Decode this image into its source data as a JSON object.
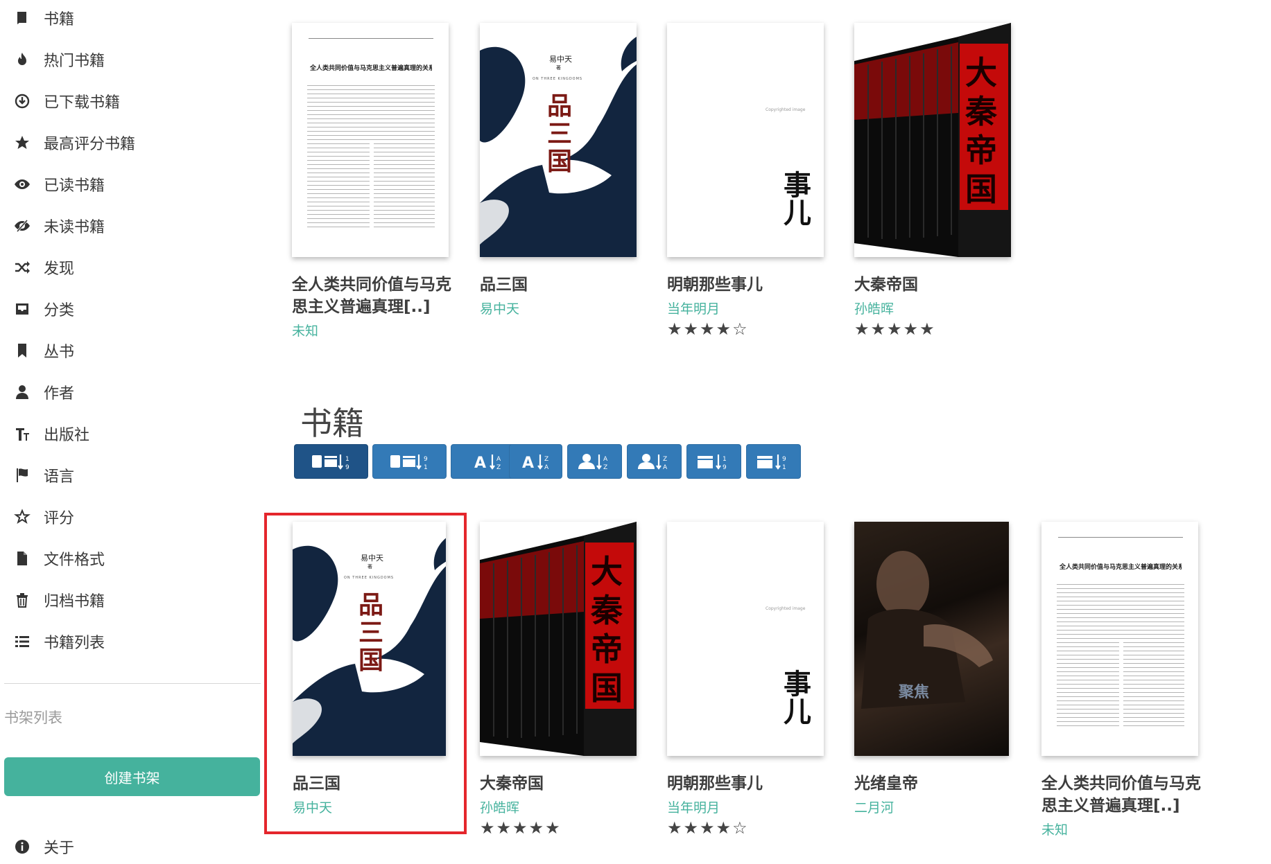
{
  "sidebar": {
    "items": [
      {
        "label": "书籍",
        "icon": "book-icon"
      },
      {
        "label": "热门书籍",
        "icon": "fire-icon"
      },
      {
        "label": "已下载书籍",
        "icon": "download-icon"
      },
      {
        "label": "最高评分书籍",
        "icon": "star-icon"
      },
      {
        "label": "已读书籍",
        "icon": "eye-icon"
      },
      {
        "label": "未读书籍",
        "icon": "eye-slash-icon"
      },
      {
        "label": "发现",
        "icon": "shuffle-icon"
      },
      {
        "label": "分类",
        "icon": "inbox-icon"
      },
      {
        "label": "丛书",
        "icon": "bookmark-icon"
      },
      {
        "label": "作者",
        "icon": "user-icon"
      },
      {
        "label": "出版社",
        "icon": "text-size-icon"
      },
      {
        "label": "语言",
        "icon": "flag-icon"
      },
      {
        "label": "评分",
        "icon": "star-outline-icon"
      },
      {
        "label": "文件格式",
        "icon": "file-icon"
      },
      {
        "label": "归档书籍",
        "icon": "trash-icon"
      },
      {
        "label": "书籍列表",
        "icon": "list-icon"
      }
    ],
    "shelf_heading": "书架列表",
    "create_shelf": "创建书架",
    "about": {
      "label": "关于",
      "icon": "info-icon"
    }
  },
  "top_books": [
    {
      "title": "全人类共同价值与马克思主义普遍真理[..]",
      "author": "未知",
      "rating": "",
      "cover": "article"
    },
    {
      "title": "品三国",
      "author": "易中天",
      "rating": "",
      "cover": "pin-san-guo"
    },
    {
      "title": "明朝那些事儿",
      "author": "当年明月",
      "rating": "★★★★☆",
      "cover": "ming-chao"
    },
    {
      "title": "大秦帝国",
      "author": "孙皓晖",
      "rating": "★★★★★",
      "cover": "da-qin"
    }
  ],
  "books_heading": "书籍",
  "sort_buttons": [
    {
      "name": "sort-date-new-button",
      "active": true
    },
    {
      "name": "sort-date-old-button",
      "active": false
    },
    {
      "name": "sort-title-asc-button",
      "active": false
    },
    {
      "name": "sort-title-desc-button",
      "active": false
    },
    {
      "name": "sort-author-asc-button",
      "active": false
    },
    {
      "name": "sort-author-desc-button",
      "active": false
    },
    {
      "name": "sort-pubdate-new-button",
      "active": false
    },
    {
      "name": "sort-pubdate-old-button",
      "active": false
    }
  ],
  "books": [
    {
      "title": "品三国",
      "author": "易中天",
      "rating": "",
      "cover": "pin-san-guo",
      "selected": true
    },
    {
      "title": "大秦帝国",
      "author": "孙皓晖",
      "rating": "★★★★★",
      "cover": "da-qin"
    },
    {
      "title": "明朝那些事儿",
      "author": "当年明月",
      "rating": "★★★★☆",
      "cover": "ming-chao"
    },
    {
      "title": "光绪皇帝",
      "author": "二月河",
      "rating": "",
      "cover": "guang-xu"
    },
    {
      "title": "全人类共同价值与马克思主义普遍真理[..]",
      "author": "未知",
      "rating": "",
      "cover": "article"
    }
  ],
  "covers": {
    "article_title": "全人类共同价值与马克思主义普遍真理的关系探析",
    "psg_author": "易中天",
    "psg_sub": "著",
    "psg_en": "ON THREE KINGDOMS",
    "psg_title": "品三国",
    "ming_text": "事儿",
    "ming_copy": "Copyrighted image",
    "qin_title": "大秦帝国",
    "gx_text": "聚焦"
  },
  "colors": {
    "accent": "#45b29d",
    "button": "#337ab7",
    "button_active": "#1f5387",
    "highlight": "#e4262c"
  }
}
